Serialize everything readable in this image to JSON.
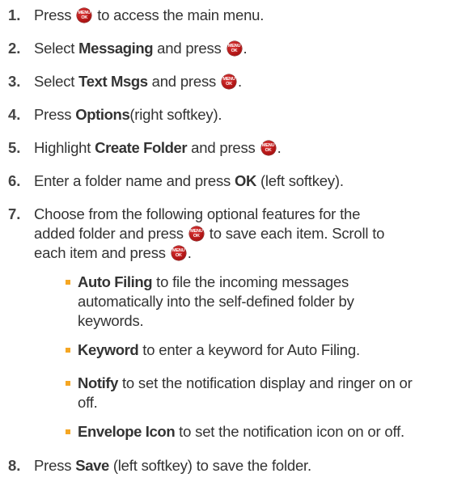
{
  "menu_key": {
    "line1": "MENU",
    "line2": "OK"
  },
  "steps": [
    {
      "num": "1.",
      "a": "Press",
      "b": "to access the main menu."
    },
    {
      "num": "2.",
      "a": "Select",
      "bold": "Messaging",
      "b": "and press",
      "c": "."
    },
    {
      "num": "3.",
      "a": "Select",
      "bold": "Text Msgs",
      "b": "and press",
      "c": "."
    },
    {
      "num": "4.",
      "a": "Press",
      "bold": "Options",
      "b": "(right softkey)."
    },
    {
      "num": "5.",
      "a": "Highlight",
      "bold": "Create Folder",
      "b": "and press",
      "c": "."
    },
    {
      "num": "6.",
      "a": "Enter a folder name and press",
      "bold": "OK",
      "b": "(left softkey)."
    },
    {
      "num": "7.",
      "line1": "Choose from the following optional features for the",
      "line2a": "added folder and press",
      "line2b": "to save each item. Scroll to",
      "line3a": "each item and press",
      "line3b": "."
    },
    {
      "num": "8.",
      "a": "Press",
      "bold": "Save",
      "b": "(left softkey) to save the folder."
    }
  ],
  "options": [
    {
      "bold": "Auto Filing",
      "lines": [
        "to file the incoming messages",
        "automatically into the self-defined folder by",
        "keywords."
      ]
    },
    {
      "bold": "Keyword",
      "lines": [
        "to enter a keyword for Auto Filing."
      ]
    },
    {
      "bold": "Notify",
      "lines": [
        "to set the notification display and ringer on or",
        "off."
      ]
    },
    {
      "bold": "Envelope Icon",
      "lines": [
        "to set the notification icon on or off."
      ]
    }
  ]
}
